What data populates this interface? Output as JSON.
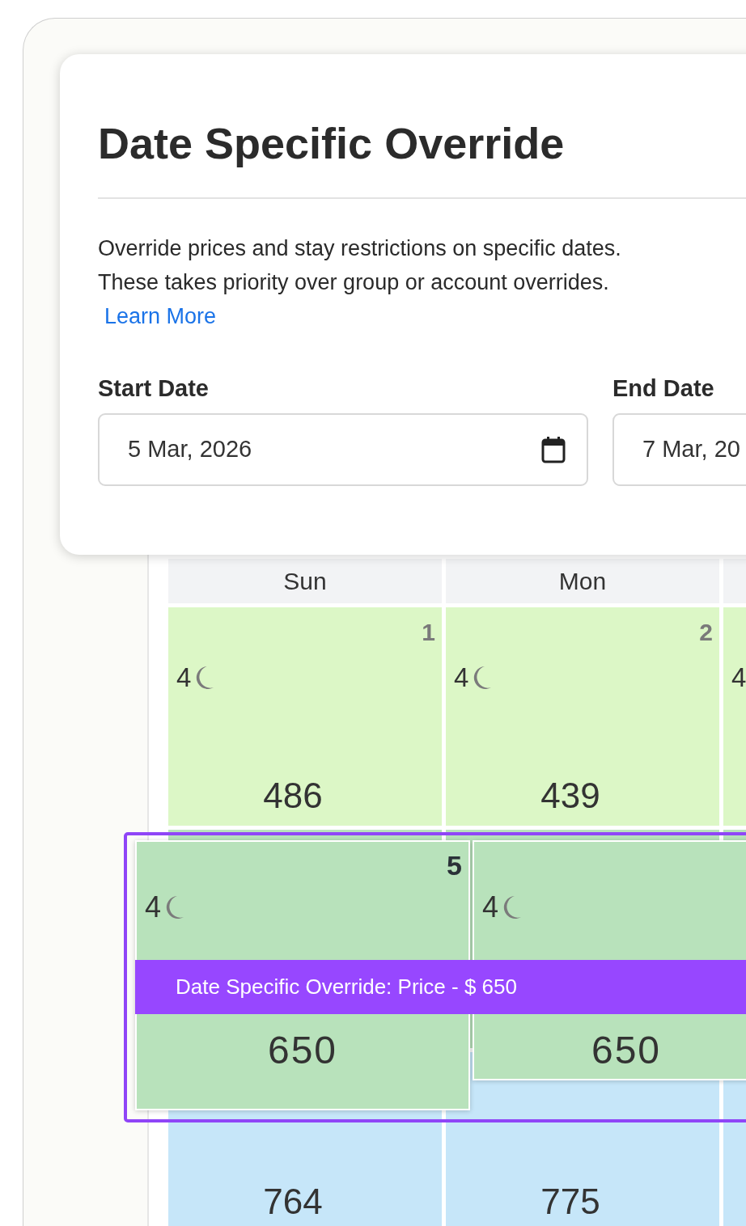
{
  "dialog": {
    "title": "Date Specific Override",
    "description": "Override prices and stay restrictions on specific dates.\nThese takes priority over group or account overrides.",
    "link": "Learn More",
    "fields": [
      {
        "label": "Start Date",
        "value": "5 Mar, 2026",
        "icon": true
      },
      {
        "label": "End Date",
        "value": "7 Mar, 20"
      }
    ]
  },
  "calendar": {
    "columns": [
      "Sun",
      "Mon",
      ""
    ],
    "weeks": [
      {
        "color": "#dcf7c6",
        "cells": [
          {
            "date": "1",
            "nights": "4",
            "moon": true,
            "price": "486"
          },
          {
            "date": "2",
            "nights": "4",
            "moon": true,
            "price": "439"
          },
          {
            "nights": "4"
          }
        ]
      },
      {
        "color": "#b8e2bb",
        "cells": [
          {},
          {},
          {}
        ]
      },
      {
        "color": "#c6e6f9",
        "cells": [
          {
            "price": "764"
          },
          {
            "price": "775"
          },
          {}
        ]
      }
    ]
  },
  "highlight": {
    "banner": "Date Specific Override: Price - $ 650",
    "cells": [
      {
        "date": "5",
        "nights": "4",
        "moon": true,
        "price": "650"
      },
      {
        "nights": "4",
        "moon": true,
        "price": "650"
      }
    ]
  }
}
